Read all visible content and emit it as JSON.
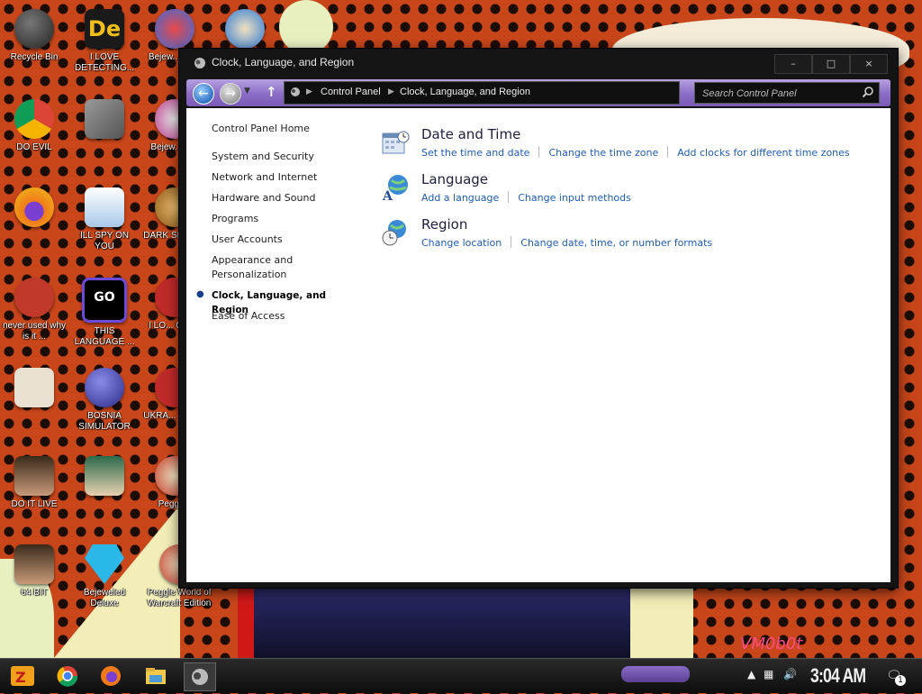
{
  "desktop": {
    "icons": [
      {
        "label": "Recycle Bin",
        "color": "#3a3a3a"
      },
      {
        "label": "I LOVE DETECTING...",
        "color": "#2b2b2b"
      },
      {
        "label": "DO EVIL",
        "color": "#e03a2f"
      },
      {
        "label": "",
        "color": "#6a6a6a"
      },
      {
        "label": "",
        "color": "#f07a1a"
      },
      {
        "label": "ILL SPY ON YOU",
        "color": "#d8e4f0"
      },
      {
        "label": "never used why is it ...",
        "color": "#c0392b"
      },
      {
        "label": "THIS LANGUAGE ...",
        "color": "#1b2a8a"
      },
      {
        "label": "",
        "color": "#e8e0d0"
      },
      {
        "label": "BOSNIA SIMULATOR",
        "color": "#4a4ab8"
      },
      {
        "label": "DO IT LIVE",
        "color": "#7a4a2a"
      },
      {
        "label": "",
        "color": "#9ab8c8"
      },
      {
        "label": "64 BIT",
        "color": "#7a4a2a"
      },
      {
        "label": "Bejeweled Deluxe",
        "color": "#2ab8e8"
      },
      {
        "label": "Peggle World of Warcraft Edition",
        "color": "#c03a2a"
      }
    ],
    "partial_icons": [
      {
        "label": "Bejew... Delu",
        "color": "#3a6ad8"
      },
      {
        "label": "Bejew... TW",
        "color": "#b83a8a"
      },
      {
        "label": "DARK SIMUL...",
        "color": "#c87a2a"
      },
      {
        "label": "I LO... CHUZ",
        "color": "#c02a2a"
      },
      {
        "label": "UKRA... SIMUL",
        "color": "#c02a2a"
      },
      {
        "label": "Peggle I",
        "color": "#c03a2a"
      }
    ],
    "wallpaper_text": [
      "",
      "",
      "VM0b0t"
    ]
  },
  "window": {
    "title": "Clock, Language, and Region",
    "controls": {
      "minimize": "–",
      "maximize": "□",
      "close": "×"
    },
    "address": {
      "crumbs": [
        "Control Panel",
        "Clock, Language, and Region"
      ]
    },
    "search": {
      "placeholder": "Search Control Panel"
    },
    "sidebar": {
      "home": "Control Panel Home",
      "items": [
        {
          "label": "System and Security"
        },
        {
          "label": "Network and Internet"
        },
        {
          "label": "Hardware and Sound"
        },
        {
          "label": "Programs"
        },
        {
          "label": "User Accounts"
        },
        {
          "label": "Appearance and Personalization"
        },
        {
          "label": "Clock, Language, and Region",
          "current": true
        },
        {
          "label": "Ease of Access"
        }
      ]
    },
    "categories": [
      {
        "title": "Date and Time",
        "icon": "calendar-clock-icon",
        "links": [
          "Set the time and date",
          "Change the time zone",
          "Add clocks for different time zones"
        ]
      },
      {
        "title": "Language",
        "icon": "globe-language-icon",
        "links": [
          "Add a language",
          "Change input methods"
        ]
      },
      {
        "title": "Region",
        "icon": "globe-clock-icon",
        "links": [
          "Change location",
          "Change date, time, or number formats"
        ]
      }
    ]
  },
  "taskbar": {
    "apps": [
      "chrome-icon",
      "firefox-icon",
      "file-explorer-icon",
      "control-panel-icon"
    ],
    "clock": "3:04 AM",
    "notification_count": "1"
  },
  "colors": {
    "accent_purple": "#8a6cc6",
    "link_blue": "#1f5cb5",
    "window_frame": "#141414"
  }
}
